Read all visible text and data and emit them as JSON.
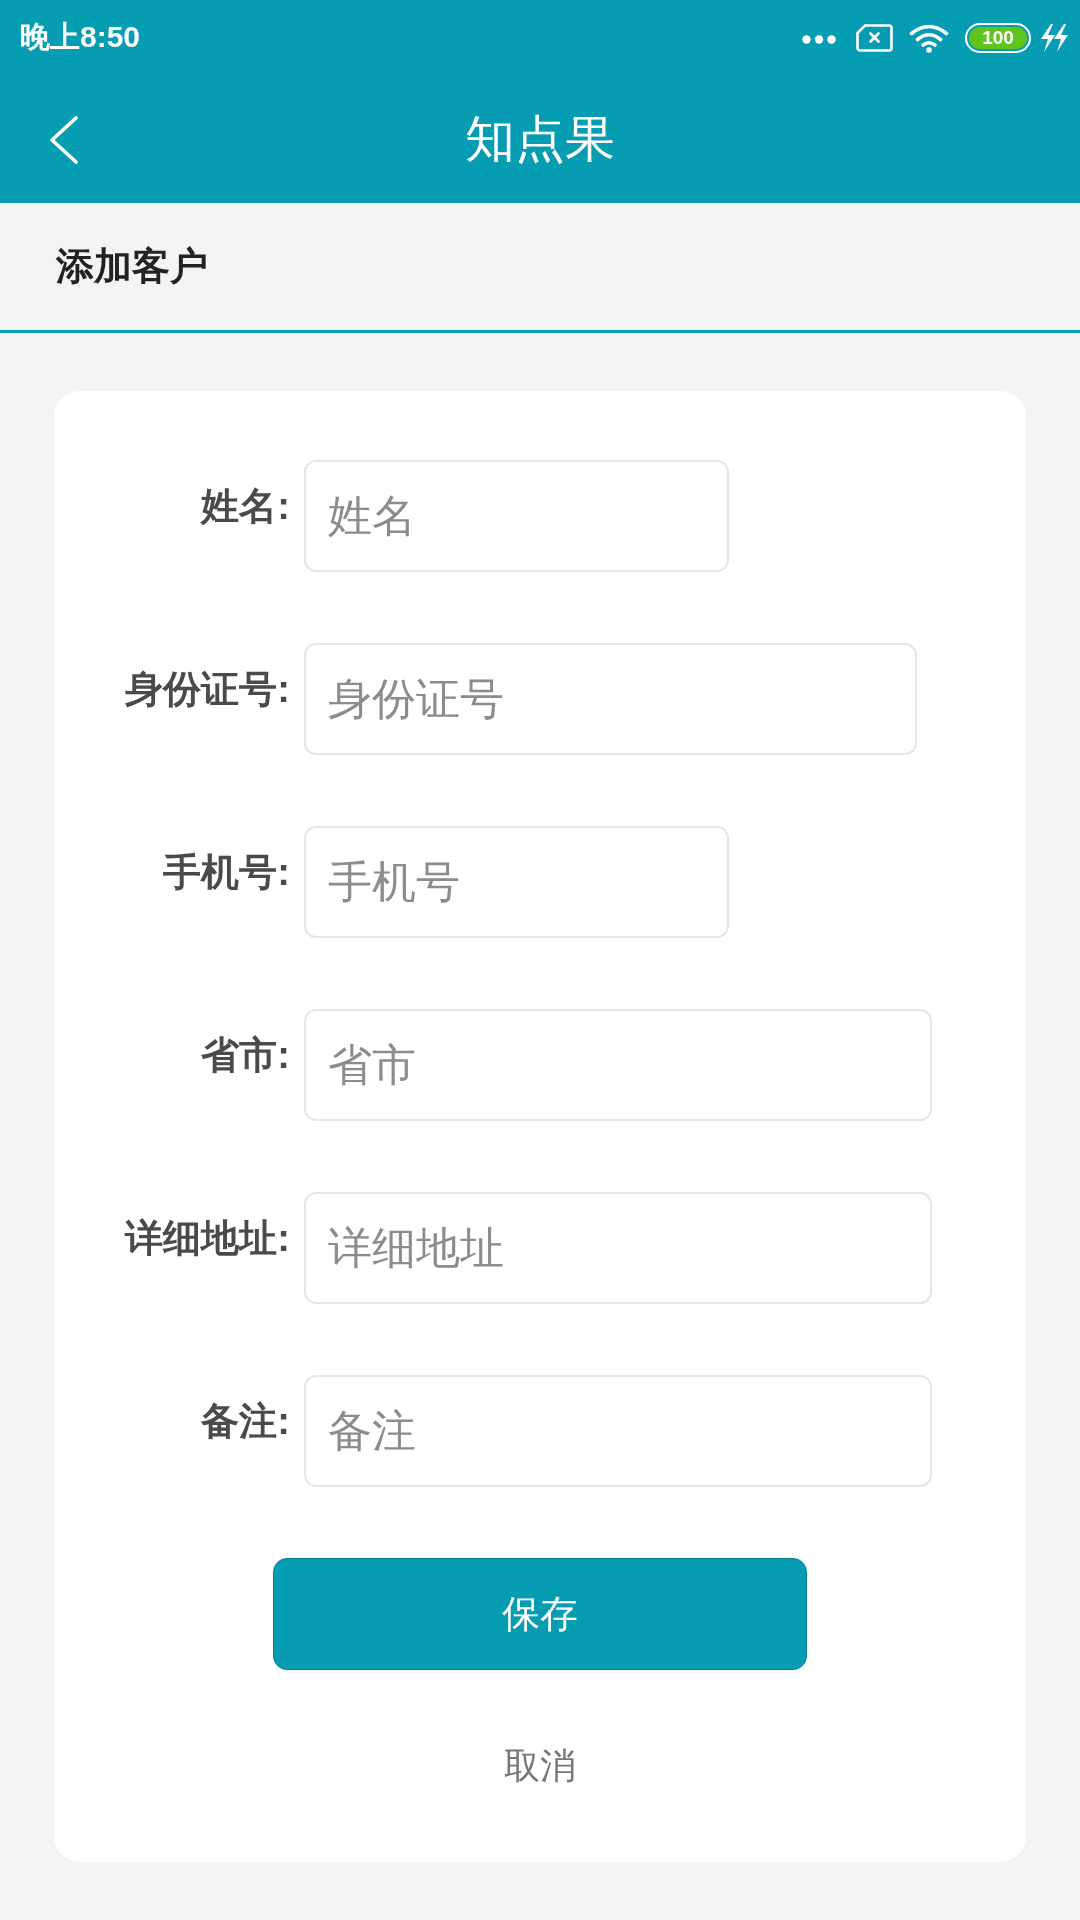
{
  "status_bar": {
    "time": "晚上8:50",
    "battery": "100"
  },
  "app_bar": {
    "title": "知点果"
  },
  "section": {
    "title": "添加客户"
  },
  "form": {
    "fields": [
      {
        "label": "姓名:",
        "placeholder": "姓名",
        "kind": "short"
      },
      {
        "label": "身份证号:",
        "placeholder": "身份证号",
        "kind": "medium"
      },
      {
        "label": "手机号:",
        "placeholder": "手机号",
        "kind": "short"
      },
      {
        "label": "省市:",
        "placeholder": "省市",
        "kind": "wide"
      },
      {
        "label": "详细地址:",
        "placeholder": "详细地址",
        "kind": "wide"
      },
      {
        "label": "备注:",
        "placeholder": "备注",
        "kind": "wide"
      }
    ],
    "buttons": [
      {
        "label": "保存",
        "kind": "primary"
      },
      {
        "label": "取消",
        "kind": "plain"
      }
    ]
  }
}
